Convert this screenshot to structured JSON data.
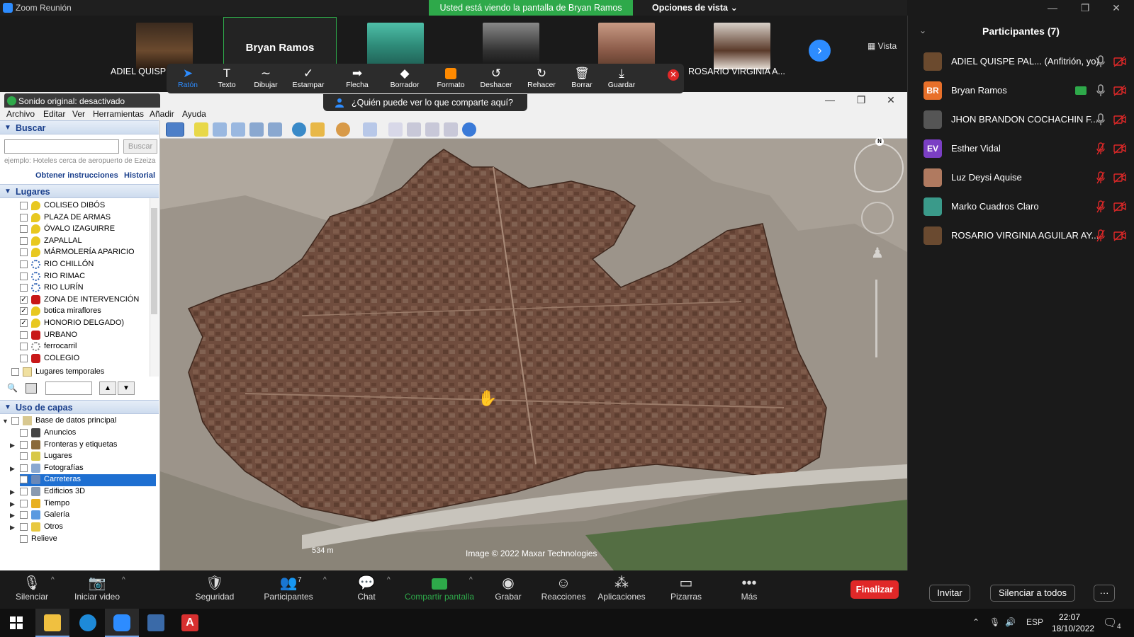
{
  "window": {
    "title": "Zoom Reunión",
    "banner": "Usted está viendo la pantalla de Bryan Ramos",
    "view_options": "Opciones de vista ⌄",
    "vista_label": "Vista"
  },
  "video_strip": {
    "tiles": [
      {
        "name": "ADIEL QUISPE"
      },
      {
        "name": "Bryan Ramos"
      },
      {
        "name": ""
      },
      {
        "name": ""
      },
      {
        "name": ""
      },
      {
        "name": "ROSARIO VIRGINIA A..."
      }
    ]
  },
  "annotation_toolbar": {
    "tools": [
      {
        "label": "Ratón",
        "icon": "pointer-icon",
        "glyph": "➤"
      },
      {
        "label": "Texto",
        "icon": "text-icon",
        "glyph": "T"
      },
      {
        "label": "Dibujar",
        "icon": "draw-icon",
        "glyph": "∼"
      },
      {
        "label": "Estampar",
        "icon": "stamp-icon",
        "glyph": "✓"
      },
      {
        "label": "Flecha",
        "icon": "arrow-icon",
        "glyph": "➡"
      },
      {
        "label": "Borrador",
        "icon": "eraser-icon",
        "glyph": "◆"
      },
      {
        "label": "Formato",
        "icon": "format-icon",
        "glyph": ""
      },
      {
        "label": "Deshacer",
        "icon": "undo-icon",
        "glyph": "↺"
      },
      {
        "label": "Rehacer",
        "icon": "redo-icon",
        "glyph": "↻"
      },
      {
        "label": "Borrar",
        "icon": "trash-icon",
        "glyph": "🗑"
      },
      {
        "label": "Guardar",
        "icon": "save-icon",
        "glyph": "⤓"
      }
    ],
    "who_can_see": "¿Quién puede ver lo que comparte aquí?"
  },
  "google_earth": {
    "original_sound": "Sonido original: desactivado",
    "menu": [
      "Archivo",
      "Editar",
      "Ver",
      "Herramientas",
      "Añadir",
      "Ayuda"
    ],
    "search": {
      "header": "Buscar",
      "button": "Buscar",
      "hint": "ejemplo: Hoteles cerca de aeropuerto de Ezeiza",
      "directions_link": "Obtener instrucciones",
      "history_link": "Historial"
    },
    "places": {
      "header": "Lugares",
      "items": [
        {
          "label": "COLISEO DIBÓS",
          "checked": false,
          "icon": "pin-yellow"
        },
        {
          "label": "PLAZA DE ARMAS",
          "checked": false,
          "icon": "pin-yellow"
        },
        {
          "label": "ÓVALO IZAGUIRRE",
          "checked": false,
          "icon": "pin-yellow"
        },
        {
          "label": "ZAPALLAL",
          "checked": false,
          "icon": "pin-yellow"
        },
        {
          "label": "MÁRMOLERÍA APARICIO",
          "checked": false,
          "icon": "pin-yellow"
        },
        {
          "label": "RIO CHILLÓN",
          "checked": false,
          "icon": "path-blue"
        },
        {
          "label": "RIO RIMAC",
          "checked": false,
          "icon": "path-blue"
        },
        {
          "label": "RIO LURÍN",
          "checked": false,
          "icon": "path-blue"
        },
        {
          "label": "ZONA DE INTERVENCIÓN",
          "checked": true,
          "icon": "polygon-red"
        },
        {
          "label": "botica miraflores",
          "checked": true,
          "icon": "pin-yellow"
        },
        {
          "label": "HONORIO DELGADO)",
          "checked": true,
          "icon": "pin-yellow"
        },
        {
          "label": "URBANO",
          "checked": false,
          "icon": "polygon-red"
        },
        {
          "label": "ferrocarril",
          "checked": false,
          "icon": "path-gray"
        },
        {
          "label": "COLEGIO",
          "checked": false,
          "icon": "polygon-red"
        }
      ],
      "temp_folder": "Lugares temporales"
    },
    "layers": {
      "header": "Uso de capas",
      "root": "Base de datos principal",
      "items": [
        {
          "label": "Anuncios",
          "expandable": false
        },
        {
          "label": "Fronteras y etiquetas",
          "expandable": true
        },
        {
          "label": "Lugares",
          "expandable": false
        },
        {
          "label": "Fotografías",
          "expandable": true
        },
        {
          "label": "Carreteras",
          "expandable": false,
          "highlighted": true
        },
        {
          "label": "Edificios 3D",
          "expandable": true
        },
        {
          "label": "Tiempo",
          "expandable": true
        },
        {
          "label": "Galería",
          "expandable": true
        },
        {
          "label": "Otros",
          "expandable": true
        }
      ],
      "relief": "Relieve"
    },
    "map": {
      "scale": "534 m",
      "copyright": "Image © 2022 Maxar Technologies",
      "compass_n": "N"
    }
  },
  "participants": {
    "title": "Participantes (7)",
    "list": [
      {
        "name": "ADIEL QUISPE PAL...  (Anfitrión, yo)",
        "initials": "",
        "color": "#6b4a2e",
        "muted": false
      },
      {
        "name": "Bryan Ramos",
        "initials": "BR",
        "color": "#e8702a",
        "muted": false,
        "sharing": true
      },
      {
        "name": "JHON BRANDON COCHACHIN F...",
        "initials": "",
        "color": "#555555",
        "muted": false
      },
      {
        "name": "Esther Vidal",
        "initials": "EV",
        "color": "#7b3fc4",
        "muted": true
      },
      {
        "name": "Luz Deysi Aquise",
        "initials": "",
        "color": "#b07a60",
        "muted": true
      },
      {
        "name": "Marko Cuadros Claro",
        "initials": "",
        "color": "#3a9a8a",
        "muted": true
      },
      {
        "name": "ROSARIO VIRGINIA AGUILAR AY...",
        "initials": "",
        "color": "#6a4a30",
        "muted": true
      }
    ],
    "invite": "Invitar",
    "mute_all": "Silenciar a todos",
    "more": "···"
  },
  "controls": {
    "items": [
      {
        "label": "Silenciar",
        "icon": "microphone-icon",
        "glyph": "🎙"
      },
      {
        "label": "Iniciar video",
        "icon": "video-off-icon",
        "glyph": "📷"
      },
      {
        "label": "Seguridad",
        "icon": "shield-icon",
        "glyph": "🛡"
      },
      {
        "label": "Participantes",
        "icon": "participants-icon",
        "glyph": "👥",
        "count": "7"
      },
      {
        "label": "Chat",
        "icon": "chat-icon",
        "glyph": "💬"
      },
      {
        "label": "Compartir pantalla",
        "icon": "share-screen-icon",
        "glyph": "⬆"
      },
      {
        "label": "Grabar",
        "icon": "record-icon",
        "glyph": "◉"
      },
      {
        "label": "Reacciones",
        "icon": "reactions-icon",
        "glyph": "☺"
      },
      {
        "label": "Aplicaciones",
        "icon": "apps-icon",
        "glyph": "⁂"
      },
      {
        "label": "Pizarras",
        "icon": "whiteboard-icon",
        "glyph": "▭"
      },
      {
        "label": "Más",
        "icon": "more-icon",
        "glyph": "•••"
      }
    ],
    "end": "Finalizar"
  },
  "taskbar": {
    "lang": "ESP",
    "time": "22:07",
    "date": "18/10/2022",
    "notifications": "4"
  }
}
